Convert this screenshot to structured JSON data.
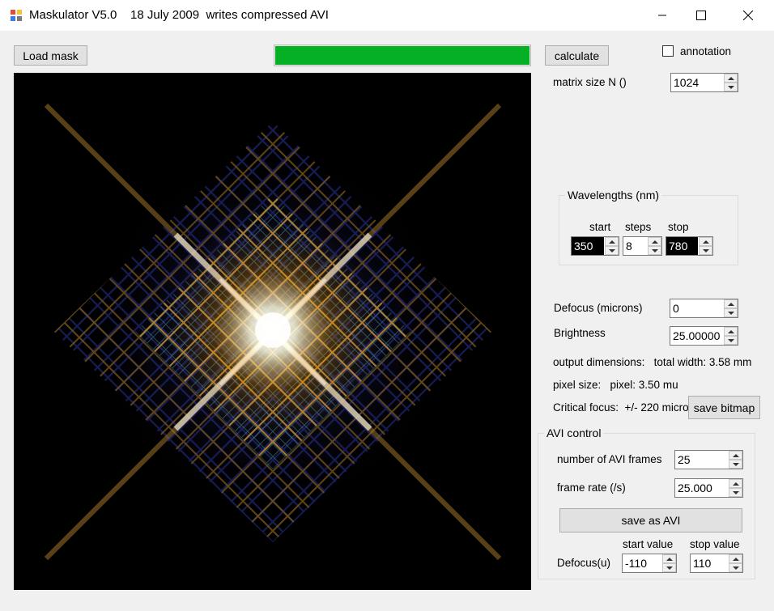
{
  "window": {
    "title": "Maskulator V5.0    18 July 2009  writes compressed AVI",
    "controls": [
      "minimize-icon",
      "maximize-icon",
      "close-icon"
    ]
  },
  "toolbar": {
    "load_mask_label": "Load mask",
    "calculate_label": "calculate",
    "progress": 1.0,
    "progress_color": "#06b025",
    "annotation_label": "annotation",
    "annotation_checked": false
  },
  "settings": {
    "matrix_size_label": "matrix size N ()",
    "matrix_size_value": "1024"
  },
  "wavelengths": {
    "title": "Wavelengths (nm)",
    "start_label": "start",
    "steps_label": "steps",
    "stop_label": "stop",
    "start_value": "350",
    "steps_value": "8",
    "stop_value": "780"
  },
  "optics": {
    "defocus_label": "Defocus (microns)",
    "defocus_value": "0",
    "brightness_label": "Brightness",
    "brightness_value": "25.00000",
    "output_dimensions": "output dimensions:   total width: 3.58 mm",
    "pixel_size": "pixel size:   pixel: 3.50 mu",
    "critical_focus": "Critical focus:  +/- 220 micro",
    "save_bitmap_label": "save bitmap"
  },
  "avi": {
    "title": "AVI control",
    "frames_label": "number of AVI frames",
    "frames_value": "25",
    "frame_rate_label": "frame rate (/s)",
    "frame_rate_value": "25.000",
    "save_label": "save as AVI",
    "defocus_label": "Defocus(u)",
    "start_value_label": "start value",
    "stop_value_label": "stop value",
    "start_value": "-110",
    "stop_value": "110"
  }
}
